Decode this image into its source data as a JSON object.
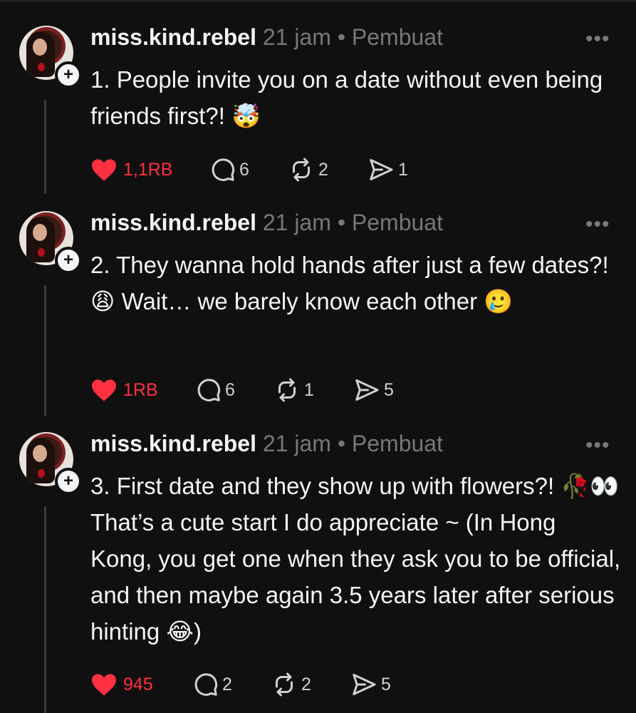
{
  "colors": {
    "background": "#101010",
    "like": "#ff3040",
    "muted": "#777777",
    "text": "#f3f5f7"
  },
  "posts": [
    {
      "username": "miss.kind.rebel",
      "meta": " 21 jam • Pembuat",
      "text": "1. People invite you on a date without even being friends first?! 🤯",
      "likes": "1,1RB",
      "replies": "6",
      "reposts": "2",
      "shares": "1"
    },
    {
      "username": "miss.kind.rebel",
      "meta": " 21 jam • Pembuat",
      "text": "2. They wanna hold hands after just a few dates?! 😩 Wait… we barely know each other 🥲",
      "likes": "1RB",
      "replies": "6",
      "reposts": "1",
      "shares": "5"
    },
    {
      "username": "miss.kind.rebel",
      "meta": " 21 jam • Pembuat",
      "text": "3. First date and they show up with flowers?! 🥀👀That’s a cute start I do appreciate ~ (In Hong Kong, you get one when they ask you to be official, and then maybe again 3.5 years later after serious hinting 😂)",
      "likes": "945",
      "replies": "2",
      "reposts": "2",
      "shares": "5"
    }
  ],
  "icons": {
    "avatar": "avatar-photo",
    "follow": "plus-icon",
    "more": "more-icon",
    "like": "heart-icon",
    "reply": "comment-icon",
    "repost": "repost-icon",
    "share": "send-icon"
  }
}
